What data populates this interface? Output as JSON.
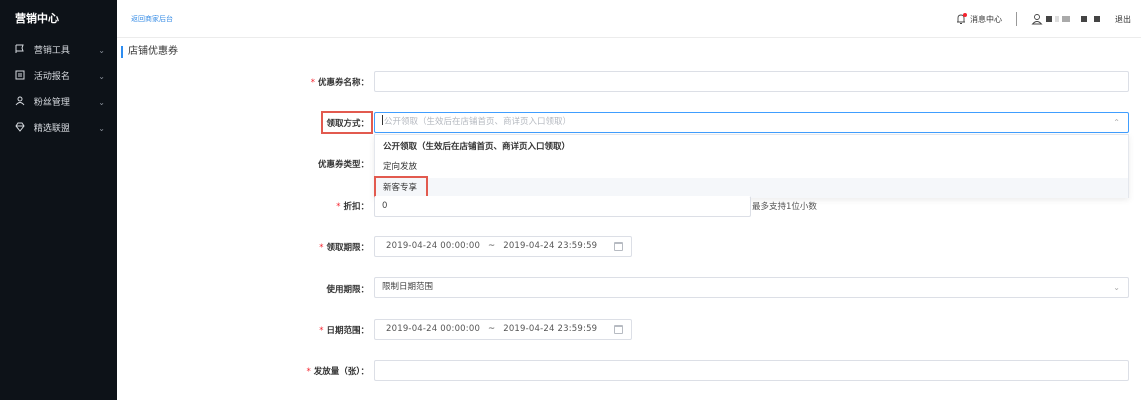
{
  "sidebar": {
    "brand": "营销中心",
    "items": [
      {
        "label": "营销工具",
        "icon": "flag-icon"
      },
      {
        "label": "活动报名",
        "icon": "calendar-icon"
      },
      {
        "label": "粉丝管理",
        "icon": "fans-icon"
      },
      {
        "label": "精选联盟",
        "icon": "diamond-icon"
      }
    ]
  },
  "header": {
    "back_link": "返回商家后台",
    "messages": "消息中心",
    "logout": "退出"
  },
  "page": {
    "section_title": "店铺优惠券"
  },
  "form": {
    "coupon_name": {
      "label": "优惠券名称：",
      "required": true,
      "value": ""
    },
    "claim_method": {
      "label": "领取方式：",
      "placeholder": "公开领取（生效后在店铺首页、商详页入口领取）"
    },
    "claim_options": [
      "公开领取（生效后在店铺首页、商详页入口领取）",
      "定向发放",
      "新客专享"
    ],
    "coupon_type": {
      "label": "优惠券类型："
    },
    "discount": {
      "label": "折扣：",
      "required": true,
      "value": "0",
      "hint": "最多支持1位小数"
    },
    "claim_period": {
      "label": "领取期限：",
      "required": true,
      "start": "2019-04-24 00:00:00",
      "sep": "~",
      "end": "2019-04-24 23:59:59"
    },
    "usage_period": {
      "label": "使用期限：",
      "value": "限制日期范围"
    },
    "date_range": {
      "label": "日期范围：",
      "required": true,
      "start": "2019-04-24 00:00:00",
      "sep": "~",
      "end": "2019-04-24 23:59:59"
    },
    "quantity": {
      "label": "发放量（张）：",
      "required": true,
      "value": ""
    }
  },
  "colors": {
    "sidebar_bg": "#0d1218",
    "accent": "#2d8cf0",
    "required": "#f5222d",
    "highlight_box": "#e25a4f"
  }
}
